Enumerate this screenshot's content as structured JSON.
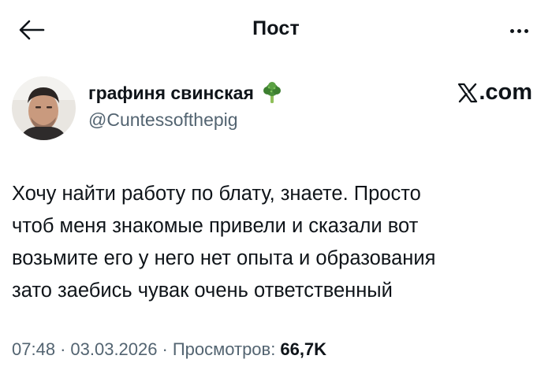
{
  "header": {
    "title": "Пост",
    "back_icon": "arrow-left-icon",
    "more_icon": "more-horizontal-icon"
  },
  "author": {
    "display_name": "графиня свинская",
    "handle": "@Cuntessofthepig",
    "badge_icon": "broccoli-icon",
    "brand": ".com"
  },
  "tweet": {
    "lines": [
      "Хочу найти работу по блату, знаете. Просто",
      "чтоб меня знакомые привели и сказали вот",
      "возьмите его у него нет опыта и образования",
      "зато заебись чувак очень ответственный"
    ]
  },
  "meta": {
    "time": "07:48",
    "separator": "·",
    "date": "03.03.2026",
    "views_label": "Просмотров:",
    "views_count": "66,7K"
  },
  "colors": {
    "text": "#0f1419",
    "secondary_text": "#536471",
    "background": "#ffffff",
    "badge_green": "#4a8f3a"
  }
}
